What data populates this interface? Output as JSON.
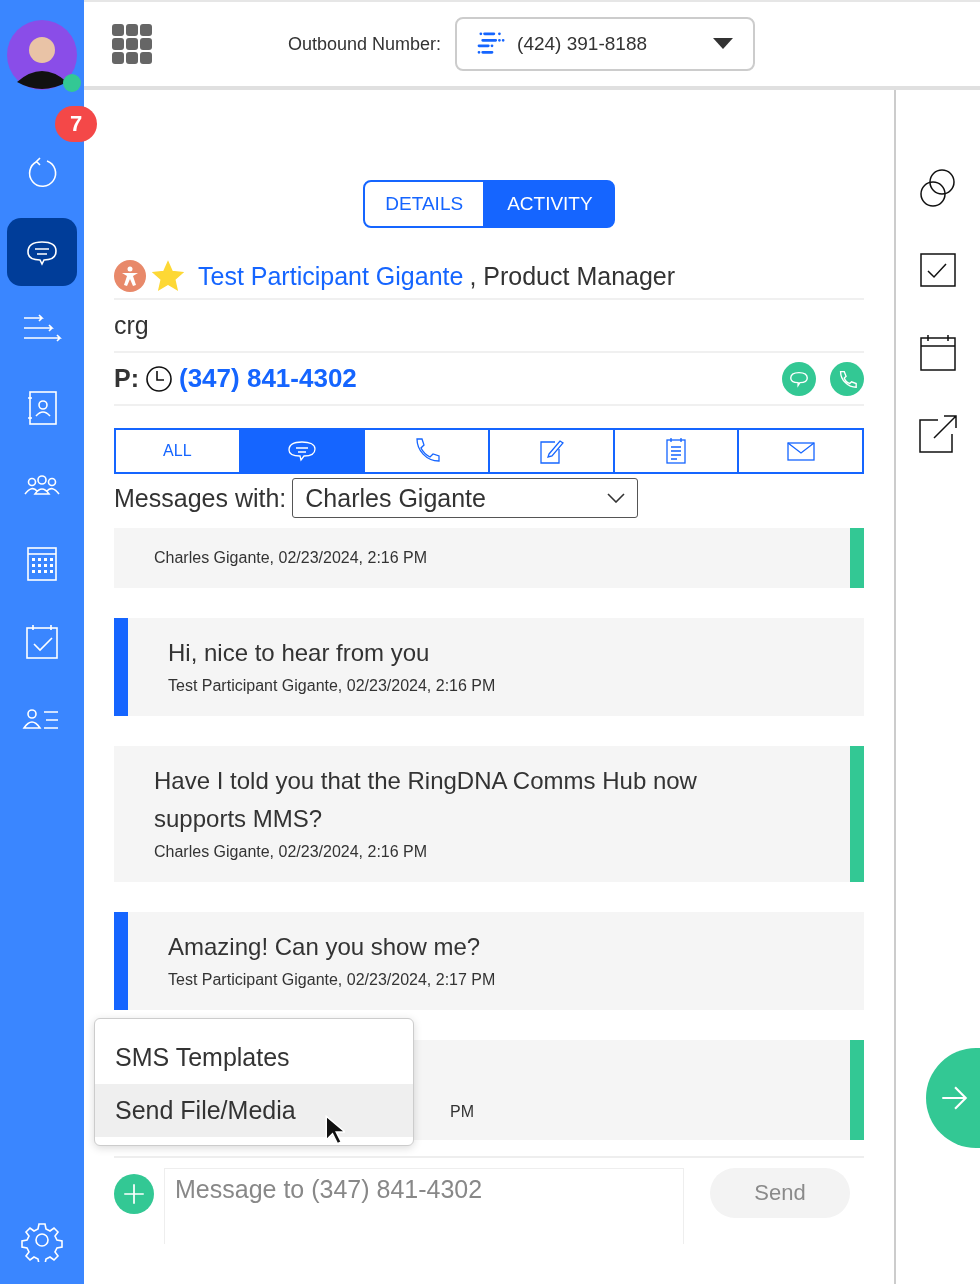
{
  "sidebar": {
    "user_online": true,
    "items": [
      {
        "kind": "refresh",
        "selected": false,
        "badge": "7"
      },
      {
        "kind": "messages",
        "selected": true
      },
      {
        "kind": "cadence",
        "selected": false
      },
      {
        "kind": "contact",
        "selected": false
      },
      {
        "kind": "team",
        "selected": false
      },
      {
        "kind": "calendar",
        "selected": false
      },
      {
        "kind": "tasks",
        "selected": false
      },
      {
        "kind": "list",
        "selected": false
      }
    ]
  },
  "header": {
    "outbound_label": "Outbound Number:",
    "outbound_number": "(424) 391-8188"
  },
  "view_tabs": [
    {
      "label": "DETAILS",
      "selected": false
    },
    {
      "label": "ACTIVITY",
      "selected": true
    }
  ],
  "contact": {
    "starred": true,
    "name": "Test Participant Gigante",
    "title": ", Product Manager",
    "company": "crg",
    "phone_label": "P:",
    "phone": "(347) 841-4302"
  },
  "filter_tabs": [
    {
      "kind": "all",
      "label": "ALL",
      "selected": false
    },
    {
      "kind": "sms",
      "selected": true
    },
    {
      "kind": "call",
      "selected": false
    },
    {
      "kind": "note",
      "selected": false
    },
    {
      "kind": "task",
      "selected": false
    },
    {
      "kind": "email",
      "selected": false
    }
  ],
  "messages_with": {
    "label": "Messages with:",
    "value": "Charles Gigante"
  },
  "messages": [
    {
      "kind": "inbound",
      "meta": "Charles Gigante, 02/23/2024, 2:16 PM",
      "covered": false
    },
    {
      "kind": "outbound",
      "text": "Hi, nice to hear from you",
      "meta": "Test Participant Gigante, 02/23/2024, 2:16 PM",
      "covered": false
    },
    {
      "kind": "inbound",
      "text": "Have I told you that the RingDNA Comms Hub now supports MMS?",
      "meta": "Charles Gigante, 02/23/2024, 2:16 PM",
      "covered": false
    },
    {
      "kind": "outbound",
      "text": "Amazing! Can you show me?",
      "meta": "Test Participant Gigante, 02/23/2024, 2:17 PM",
      "covered": false
    },
    {
      "kind": "inbound",
      "meta": "PM",
      "covered": true
    }
  ],
  "attach_menu": [
    {
      "label": "SMS Templates",
      "selected": false
    },
    {
      "label": "Send File/Media",
      "selected": true
    }
  ],
  "composer": {
    "placeholder": "Message to (347) 841-4302",
    "send": "Send",
    "send_disabled": true
  }
}
